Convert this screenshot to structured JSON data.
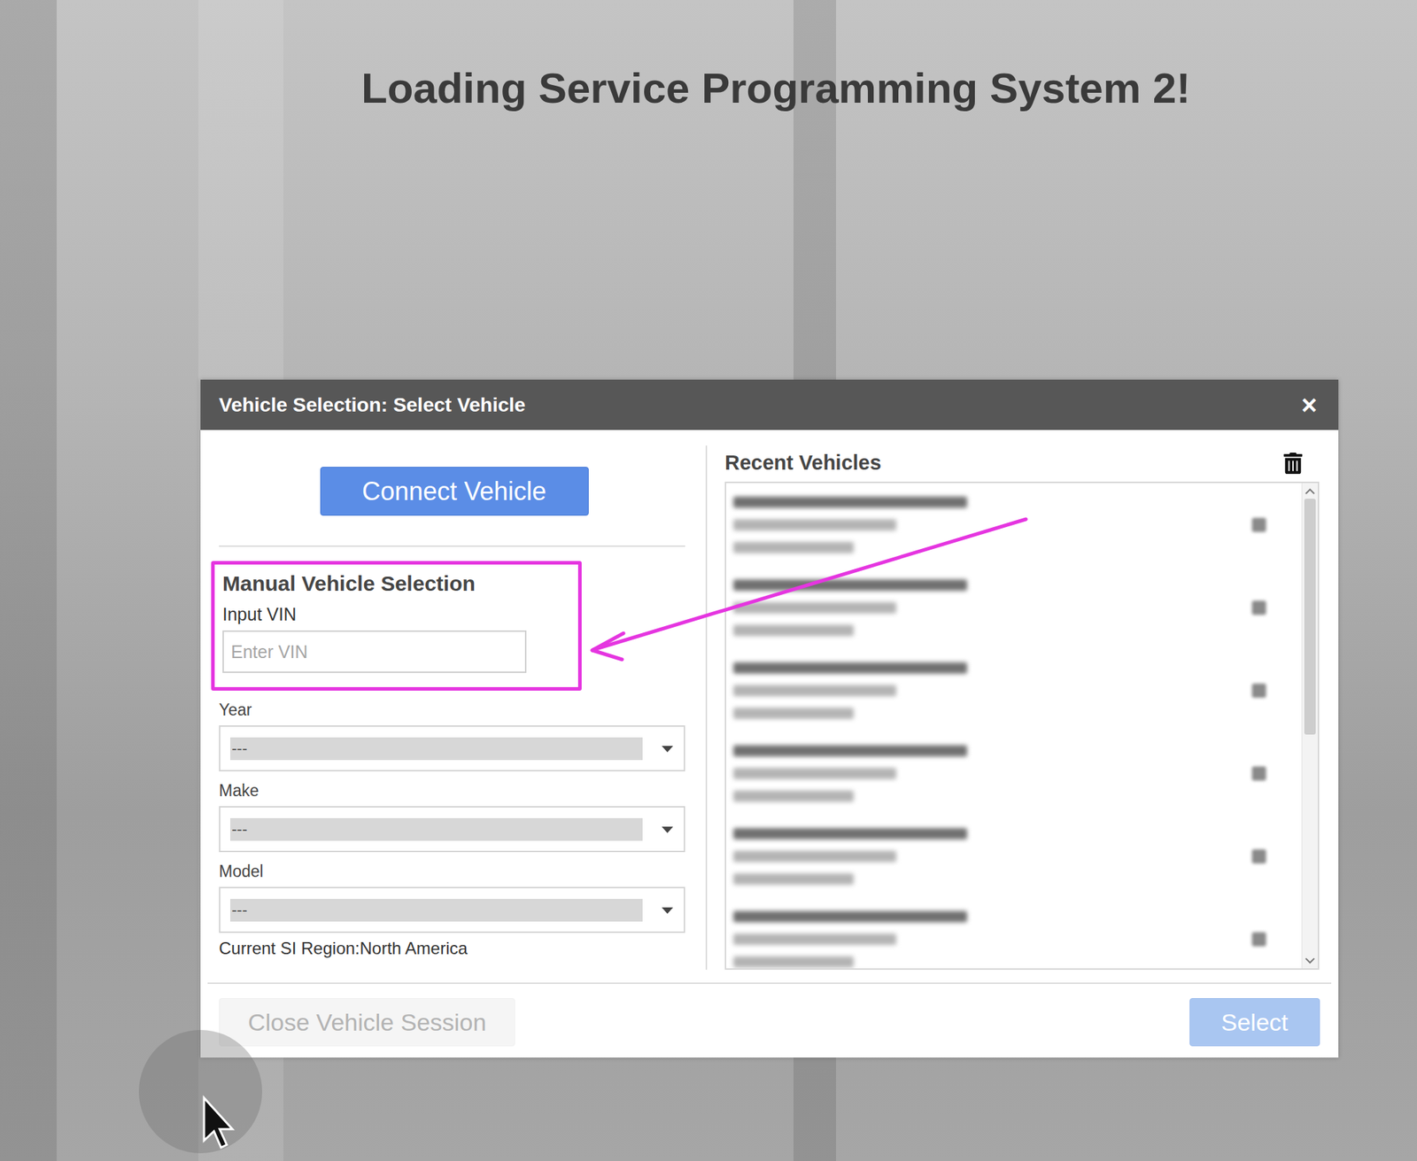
{
  "page": {
    "title": "Loading Service Programming System 2!"
  },
  "dialog": {
    "title": "Vehicle Selection: Select Vehicle",
    "close": "×"
  },
  "connect_button": {
    "label": "Connect Vehicle"
  },
  "manual": {
    "heading": "Manual Vehicle Selection",
    "vin_label": "Input VIN",
    "vin_placeholder": "Enter VIN",
    "highlighted": true
  },
  "selects": [
    {
      "label": "Year",
      "value": "---",
      "disabled": true
    },
    {
      "label": "Make",
      "value": "---",
      "disabled": true
    },
    {
      "label": "Model",
      "value": "---",
      "disabled": true
    }
  ],
  "region": "Current SI Region:North America",
  "recent": {
    "title": "Recent Vehicles",
    "items": [
      {
        "redacted": true
      },
      {
        "redacted": true
      },
      {
        "redacted": true
      },
      {
        "redacted": true
      },
      {
        "redacted": true
      },
      {
        "redacted": true
      }
    ],
    "scroll": {
      "position": 0,
      "visible_share": 0.52
    }
  },
  "footer": {
    "buttons": [
      {
        "label": "Close Vehicle Session",
        "disabled": true,
        "kind": "secondary"
      },
      {
        "label": "Select",
        "disabled": true,
        "kind": "primary"
      }
    ]
  }
}
